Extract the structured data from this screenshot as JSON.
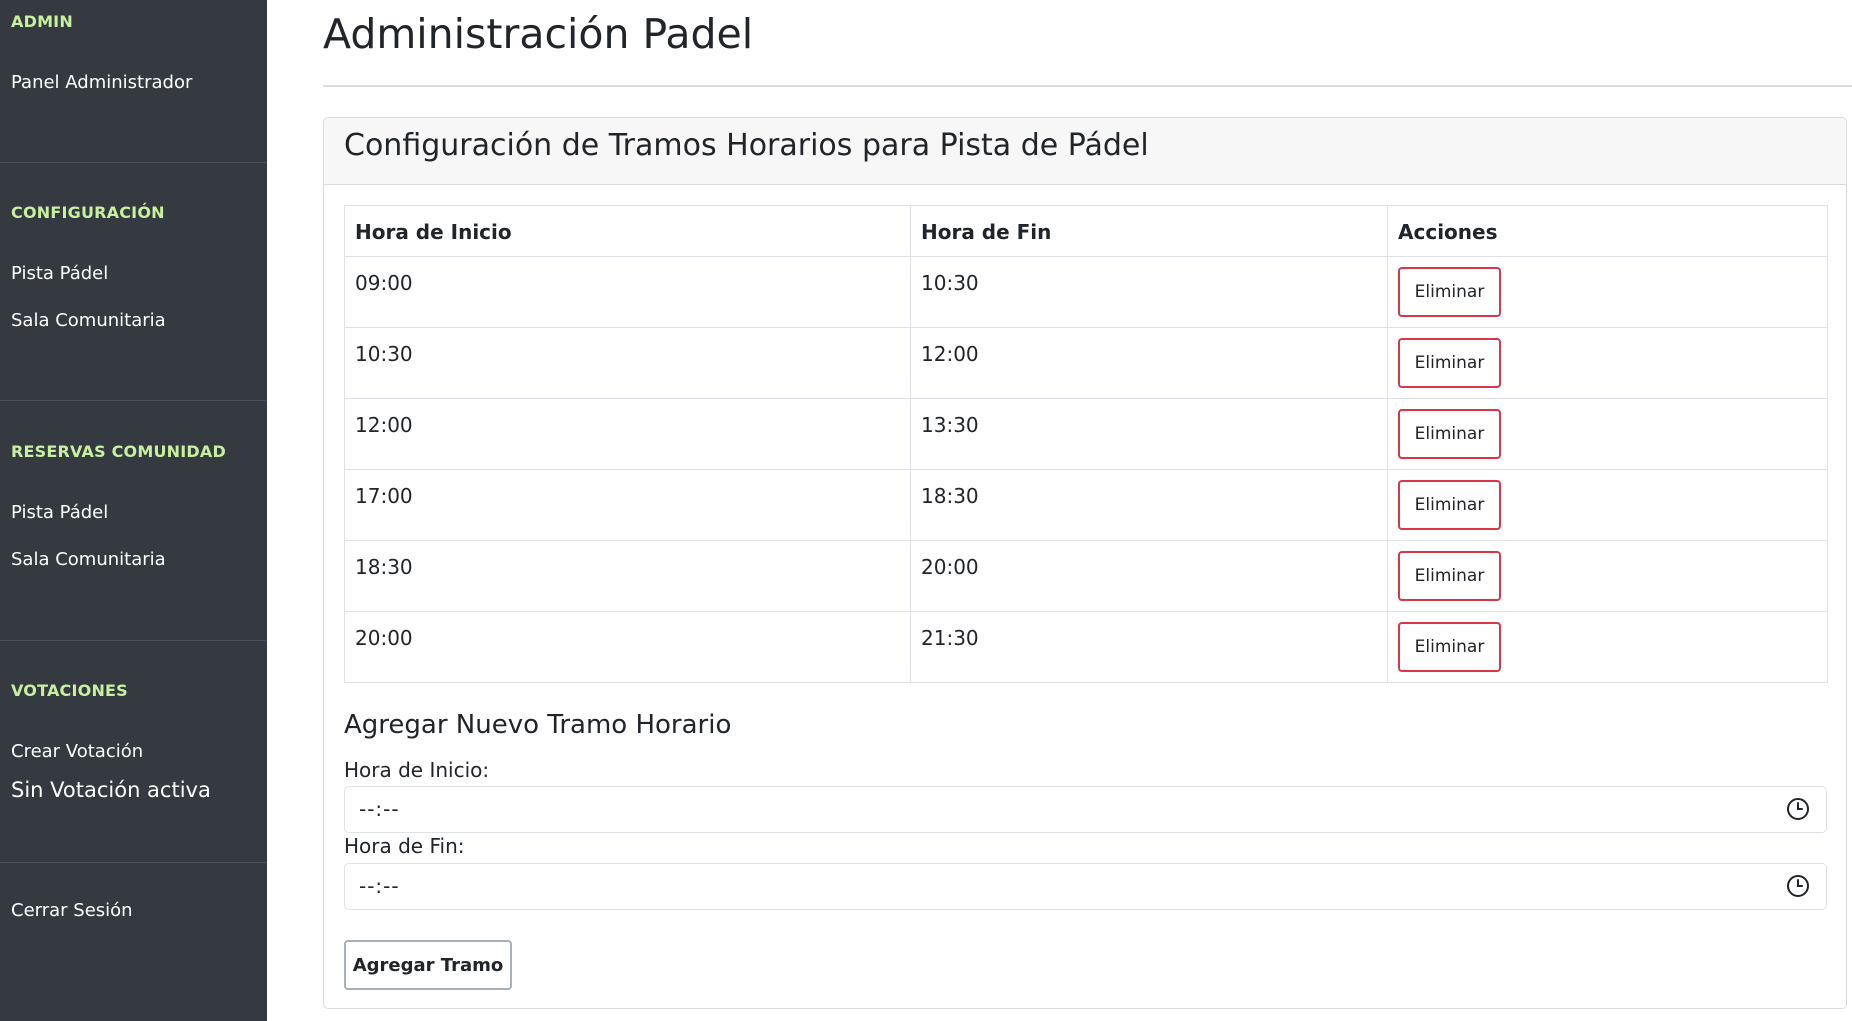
{
  "colors": {
    "sidebar_bg": "#343a40",
    "sidebar_heading": "#c8f0a0",
    "danger": "#dc3545"
  },
  "sidebar": {
    "sections": [
      {
        "heading": "ADMIN",
        "items": [
          "Panel Administrador"
        ]
      },
      {
        "heading": "CONFIGURACIÓN",
        "items": [
          "Pista Pádel",
          "Sala Comunitaria"
        ]
      },
      {
        "heading": "RESERVAS COMUNIDAD",
        "items": [
          "Pista Pádel",
          "Sala Comunitaria"
        ]
      },
      {
        "heading": "VOTACIONES",
        "items": [
          "Crear Votación"
        ],
        "status": "Sin Votación activa"
      }
    ],
    "logout": "Cerrar Sesión"
  },
  "main": {
    "title": "Administración Padel",
    "card": {
      "title": "Configuración de Tramos Horarios para Pista de Pádel",
      "table": {
        "headers": [
          "Hora de Inicio",
          "Hora de Fin",
          "Acciones"
        ],
        "rows": [
          {
            "start": "09:00",
            "end": "10:30",
            "action": "Eliminar"
          },
          {
            "start": "10:30",
            "end": "12:00",
            "action": "Eliminar"
          },
          {
            "start": "12:00",
            "end": "13:30",
            "action": "Eliminar"
          },
          {
            "start": "17:00",
            "end": "18:30",
            "action": "Eliminar"
          },
          {
            "start": "18:30",
            "end": "20:00",
            "action": "Eliminar"
          },
          {
            "start": "20:00",
            "end": "21:30",
            "action": "Eliminar"
          }
        ]
      },
      "add_form": {
        "title": "Agregar Nuevo Tramo Horario",
        "start_label": "Hora de Inicio:",
        "start_value": "--:--",
        "end_label": "Hora de Fin:",
        "end_value": "--:--",
        "submit": "Agregar Tramo",
        "field_icon": "clock-icon"
      }
    }
  }
}
